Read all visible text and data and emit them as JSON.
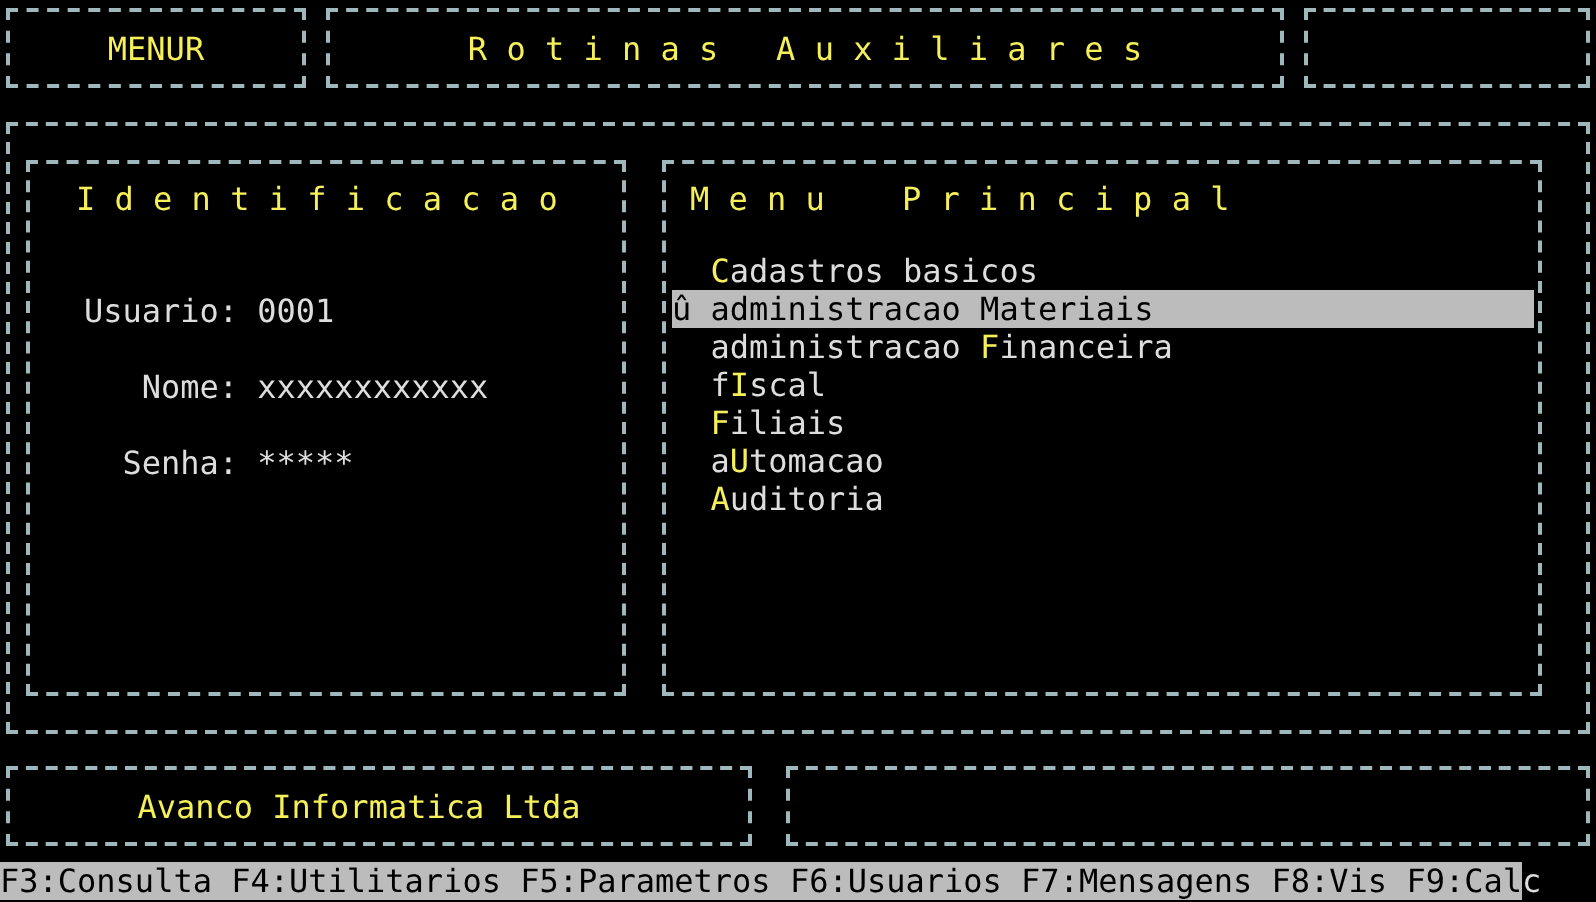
{
  "header": {
    "program": "MENUR",
    "title": "R o t i n a s   A u x i l i a r e s"
  },
  "identification": {
    "title": "I d e n t i f i c a c a o",
    "fields": [
      {
        "label": "Usuario:",
        "value": "0001"
      },
      {
        "label": "Nome:",
        "value": "xxxxxxxxxxxx"
      },
      {
        "label": "Senha:",
        "value": "*****"
      }
    ]
  },
  "menu": {
    "title": "M e n u    P r i n c i p a l",
    "items": [
      {
        "hotkey": "C",
        "after": "adastros basicos",
        "selected": false
      },
      {
        "marker": "û",
        "hotkey": "a",
        "after": "dministracao Materiais",
        "selected": true
      },
      {
        "before": "administracao ",
        "hotkey": "F",
        "after": "inanceira",
        "selected": false
      },
      {
        "before": "f",
        "hotkey": "I",
        "after": "scal",
        "selected": false
      },
      {
        "hotkey": "F",
        "after": "iliais",
        "selected": false
      },
      {
        "before": "a",
        "hotkey": "U",
        "after": "tomacao",
        "selected": false
      },
      {
        "hotkey": "A",
        "after": "uditoria",
        "selected": false
      }
    ]
  },
  "footer": {
    "company": "Avanco Informatica Ltda"
  },
  "status_bar": {
    "text": "F3:Consulta F4:Utilitarios F5:Parametros F6:Usuarios F7:Mensagens F8:Vis F9:Cal",
    "cursor": "c"
  }
}
